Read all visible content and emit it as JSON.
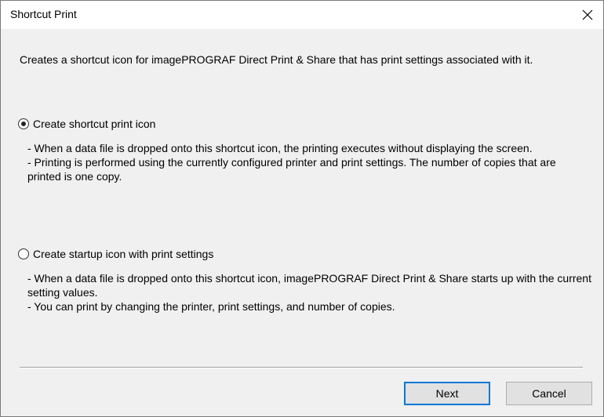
{
  "window": {
    "title": "Shortcut Print",
    "close_icon": "close-icon"
  },
  "description": "Creates a shortcut icon for imagePROGRAF Direct Print & Share that has print settings associated with it.",
  "options": [
    {
      "label": "Create shortcut print icon",
      "selected": true,
      "details": [
        " - When a data file is dropped onto this shortcut icon, the printing executes without displaying the screen.",
        " - Printing is performed using the currently configured printer and print settings. The number of copies that are printed is one copy."
      ]
    },
    {
      "label": "Create startup icon with print settings",
      "selected": false,
      "details": [
        " - When a data file is dropped onto this shortcut icon, imagePROGRAF Direct Print & Share starts up with the current setting values.",
        " - You can print by changing the printer, print settings, and number of copies."
      ]
    }
  ],
  "buttons": {
    "next_label": "Next",
    "cancel_label": "Cancel"
  },
  "colors": {
    "dialog_background": "#f0f0f0",
    "titlebar_background": "#ffffff",
    "default_button_border": "#0078d7"
  }
}
